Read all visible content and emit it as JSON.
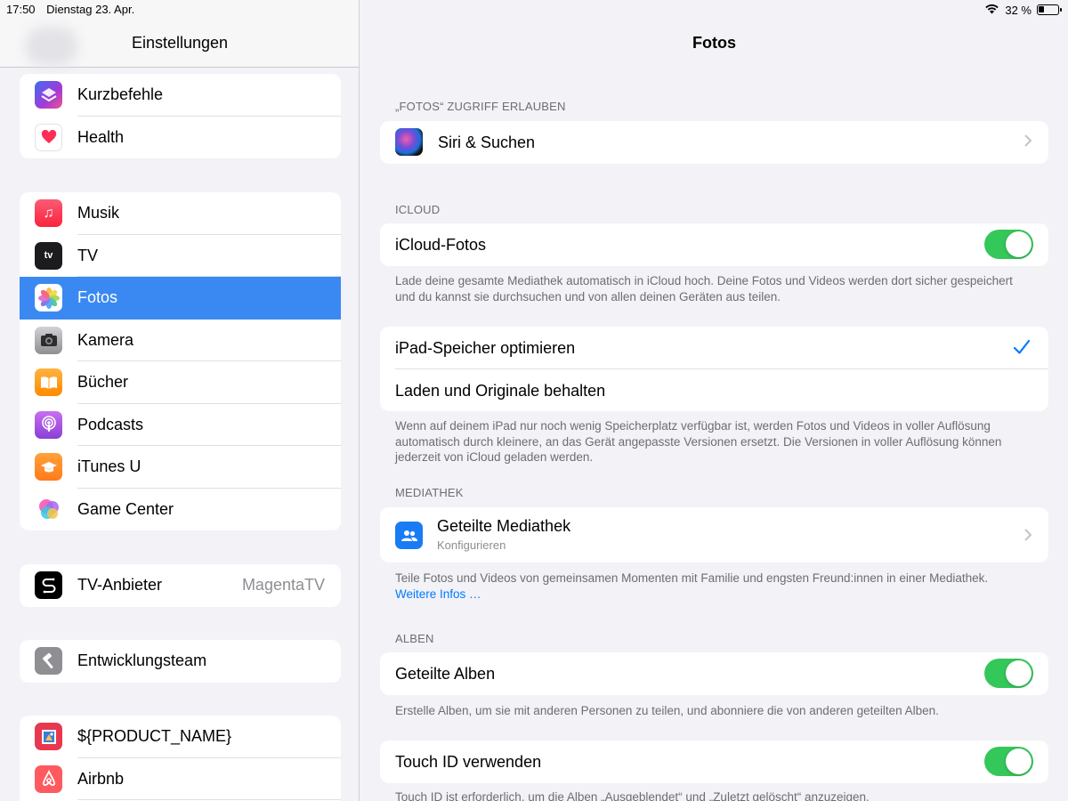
{
  "status_bar": {
    "time": "17:50",
    "date": "Dienstag 23. Apr.",
    "battery": "32 %",
    "battery_level": 0.32
  },
  "sidebar": {
    "title": "Einstellungen",
    "groups": [
      {
        "items": [
          {
            "label": "Kurzbefehle",
            "icon": "shortcuts-icon",
            "color": "#5b3fd6"
          },
          {
            "label": "Health",
            "icon": "heart-icon",
            "color": "#ff2d55"
          }
        ]
      },
      {
        "items": [
          {
            "label": "Musik",
            "icon": "music-note-icon",
            "color": "#fc3c44"
          },
          {
            "label": "TV",
            "icon": "apple-tv-icon",
            "color": "#1c1c1e"
          },
          {
            "label": "Fotos",
            "icon": "photos-flower-icon",
            "color": "#ffffff",
            "selected": true
          },
          {
            "label": "Kamera",
            "icon": "camera-icon",
            "color": "#8e8e93"
          },
          {
            "label": "Bücher",
            "icon": "book-icon",
            "color": "#ff9500"
          },
          {
            "label": "Podcasts",
            "icon": "podcast-icon",
            "color": "#9b4fd9"
          },
          {
            "label": "iTunes U",
            "icon": "graduation-cap-icon",
            "color": "#ff8c1a"
          },
          {
            "label": "Game Center",
            "icon": "game-center-icon",
            "color": "#ffffff"
          }
        ]
      },
      {
        "items": [
          {
            "label": "TV-Anbieter",
            "value": "MagentaTV",
            "icon": "tv-provider-icon",
            "color": "#000000"
          }
        ]
      },
      {
        "items": [
          {
            "label": "Entwicklungsteam",
            "icon": "hammer-icon",
            "color": "#8e8e93"
          }
        ]
      },
      {
        "items": [
          {
            "label": "${PRODUCT_NAME}",
            "icon": "product-app-icon",
            "color": "#e8384f"
          },
          {
            "label": "Airbnb",
            "icon": "airbnb-icon",
            "color": "#ff5a5f"
          }
        ]
      }
    ]
  },
  "detail": {
    "title": "Fotos",
    "sections": {
      "access": {
        "header": "„FOTOS“ ZUGRIFF ERLAUBEN",
        "row": "Siri & Suchen"
      },
      "icloud": {
        "header": "ICLOUD",
        "row": "iCloud-Fotos",
        "toggle_on": true,
        "footer": "Lade deine gesamte Mediathek automatisch in iCloud hoch. Deine Fotos und Videos werden dort sicher gespeichert und du kannst sie durchsuchen und von allen deinen Geräten aus teilen."
      },
      "storage": {
        "option1": "iPad-Speicher optimieren",
        "option2": "Laden und Originale behalten",
        "selected": "iPad-Speicher optimieren",
        "footer": "Wenn auf deinem iPad nur noch wenig Speicherplatz verfügbar ist, werden Fotos und Videos in voller Auflösung automatisch durch kleinere, an das Gerät angepasste Versionen ersetzt. Die Versionen in voller Auflösung können jederzeit von iCloud geladen werden."
      },
      "library": {
        "header": "MEDIATHEK",
        "row": "Geteilte Mediathek",
        "subtitle": "Konfigurieren",
        "footer": "Teile Fotos und Videos von gemeinsamen Momenten mit Familie und engsten Freund:innen in einer Mediathek.",
        "link": "Weitere Infos …"
      },
      "albums": {
        "header": "ALBEN",
        "row": "Geteilte Alben",
        "toggle_on": true,
        "footer": "Erstelle Alben, um sie mit anderen Personen zu teilen, und abonniere die von anderen geteilten Alben."
      },
      "touchid": {
        "row": "Touch ID verwenden",
        "toggle_on": true,
        "footer": "Touch ID ist erforderlich, um die Alben „Ausgeblendet“ und „Zuletzt gelöscht“ anzuzeigen."
      }
    }
  }
}
